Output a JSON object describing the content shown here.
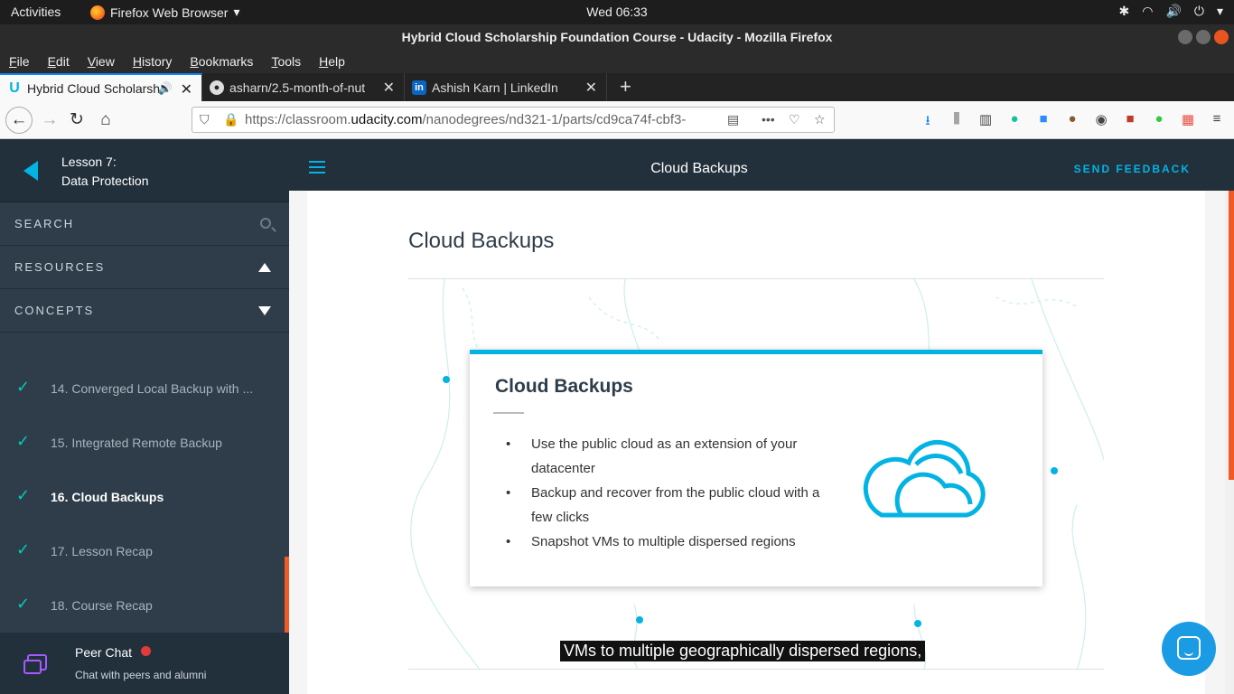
{
  "system": {
    "activities": "Activities",
    "app_name": "Firefox Web Browser",
    "clock": "Wed 06:33"
  },
  "window": {
    "title": "Hybrid Cloud Scholarship Foundation Course - Udacity - Mozilla Firefox"
  },
  "menu": [
    "File",
    "Edit",
    "View",
    "History",
    "Bookmarks",
    "Tools",
    "Help"
  ],
  "tabs": [
    {
      "label": "Hybrid Cloud Scholarsh",
      "favicon": "udacity-icon",
      "active": true
    },
    {
      "label": "asharn/2.5-month-of-nut",
      "favicon": "github-icon",
      "active": false
    },
    {
      "label": "Ashish Karn | LinkedIn",
      "favicon": "linkedin-icon",
      "active": false
    }
  ],
  "navbar": {
    "url_prefix": "https://classroom.",
    "url_domain": "udacity.com",
    "url_rest": "/nanodegrees/nd321-1/parts/cd9ca74f-cbf3-"
  },
  "sidebar": {
    "lesson_number": "Lesson 7:",
    "lesson_name": "Data Protection",
    "search_label": "SEARCH",
    "resources_label": "RESOURCES",
    "concepts_label": "CONCEPTS",
    "concepts": [
      {
        "label": "14. Converged Local Backup with ...",
        "done": true,
        "active": false
      },
      {
        "label": "15. Integrated Remote Backup",
        "done": true,
        "active": false
      },
      {
        "label": "16. Cloud Backups",
        "done": true,
        "active": true
      },
      {
        "label": "17. Lesson Recap",
        "done": true,
        "active": false
      },
      {
        "label": "18. Course Recap",
        "done": true,
        "active": false
      }
    ],
    "peer_chat_title": "Peer Chat",
    "peer_chat_subtitle": "Chat with peers and alumni"
  },
  "header": {
    "title": "Cloud Backups",
    "feedback": "SEND FEEDBACK"
  },
  "main": {
    "heading": "Cloud Backups",
    "slide": {
      "title": "Cloud Backups",
      "bullets": [
        "Use the public cloud as an extension of your datacenter",
        "Backup and recover from the public cloud with a few clicks",
        "Snapshot VMs to multiple dispersed regions"
      ]
    },
    "caption": "VMs to multiple geographically dispersed regions,"
  },
  "colors": {
    "accent": "#02b3e4",
    "sidebar_bg": "#2e3d49",
    "header_bg": "#22303b",
    "check": "#02ccba",
    "progress": "#f15a24"
  }
}
